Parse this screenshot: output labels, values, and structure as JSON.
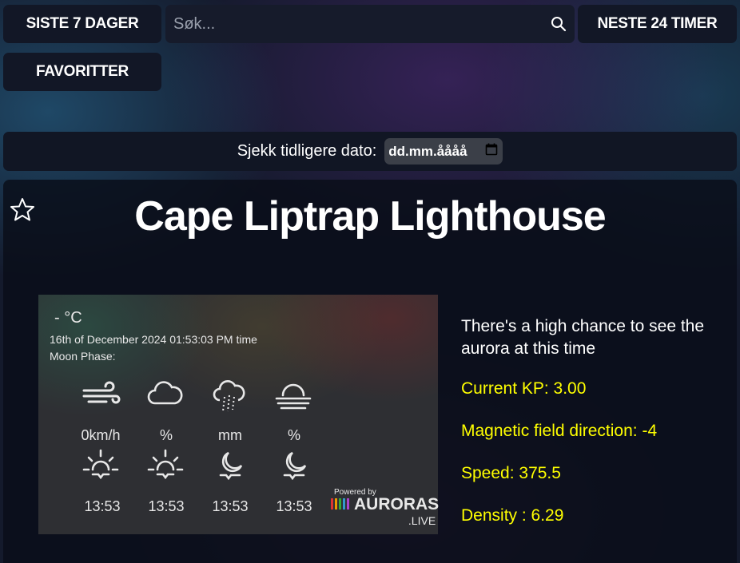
{
  "nav": {
    "last7": "SISTE 7 DAGER",
    "next24": "NESTE 24 TIMER",
    "favorites": "FAVORITTER"
  },
  "search": {
    "placeholder": "Søk..."
  },
  "date_picker": {
    "label": "Sjekk tidligere dato:",
    "value": "dd.mm.åååå"
  },
  "location": {
    "title": "Cape Liptrap Lighthouse"
  },
  "widget": {
    "temperature": "- °C",
    "datetime": "16th of December 2024 01:53:03 PM  time",
    "moon_phase": "Moon Phase:",
    "wind": "0km/h",
    "cloud": "%",
    "rain": "mm",
    "fog": "%",
    "sunrise": "13:53",
    "sunset": "13:53",
    "moonrise": "13:53",
    "moonset": "13:53",
    "powered_by": "Powered by",
    "brand": "AURORAS",
    "brand_suffix": ".LIVE"
  },
  "aurora": {
    "chance": "There's a high chance to see the aurora at this time",
    "kp": "Current KP: 3.00",
    "bz": "Magnetic field direction: -4",
    "speed": "Speed: 375.5",
    "density": "Density : 6.29"
  },
  "colors": {
    "accent_yellow": "#ffff00",
    "button_bg": "#121726",
    "card_bg": "#0e1320"
  },
  "icons": [
    "search-icon",
    "calendar-icon",
    "star-outline-icon",
    "wind-icon",
    "cloud-icon",
    "rain-icon",
    "fog-icon",
    "sunrise-icon",
    "sunset-icon",
    "moonrise-icon",
    "moonset-icon",
    "auroras-logo"
  ]
}
